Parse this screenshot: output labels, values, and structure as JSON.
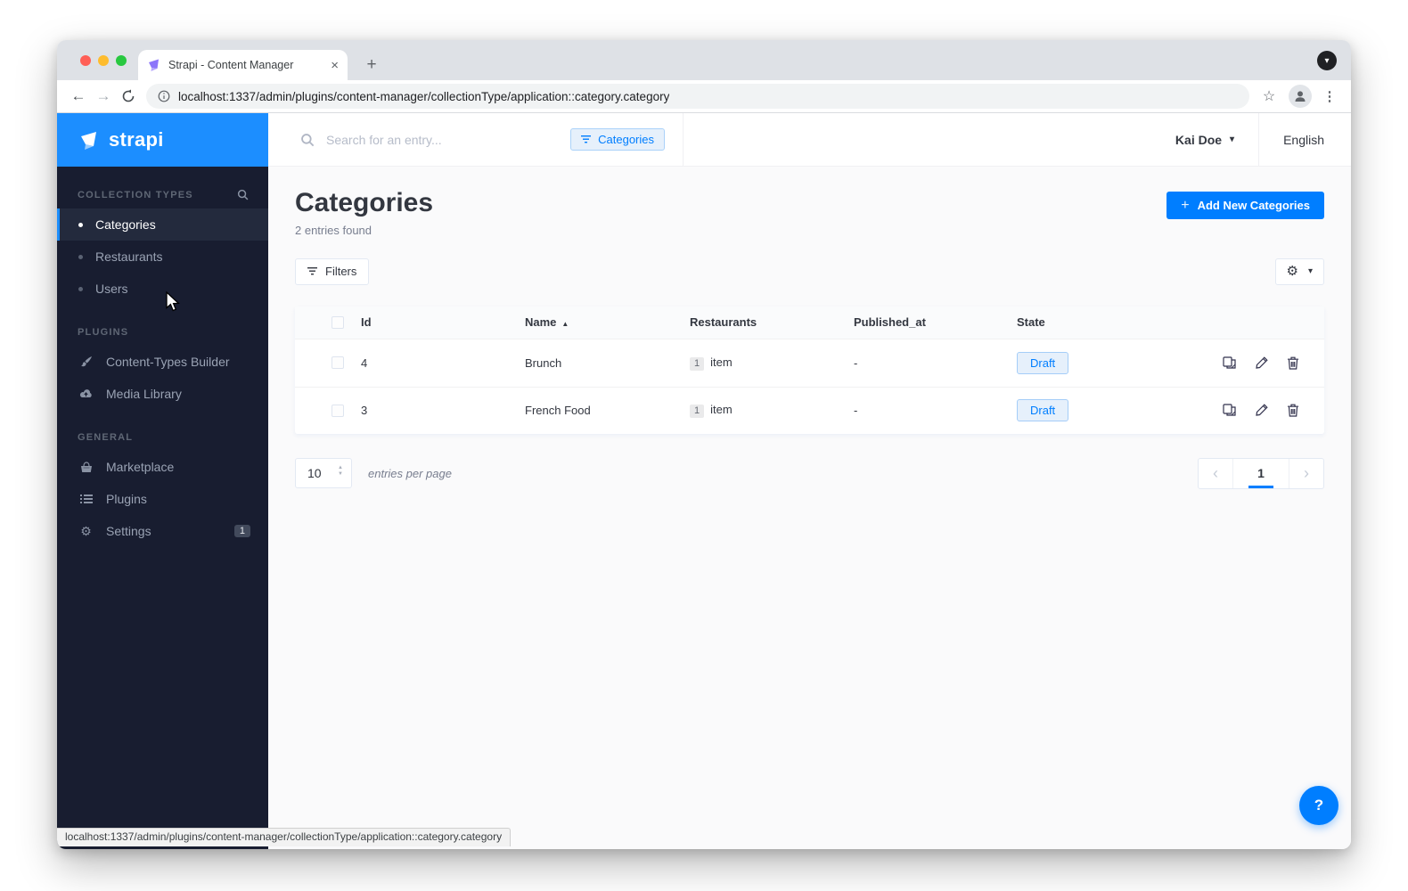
{
  "browser": {
    "tab_title": "Strapi - Content Manager",
    "url": "localhost:1337/admin/plugins/content-manager/collectionType/application::category.category",
    "status_url": "localhost:1337/admin/plugins/content-manager/collectionType/application::category.category"
  },
  "icons": {
    "close": "×",
    "plus": "+",
    "caret_down": "▾",
    "chevron_down": "▾",
    "sort_asc": "▲",
    "chevron_left": "‹",
    "chevron_right": "›",
    "star": "☆",
    "dots": "⋮",
    "back": "←",
    "forward": "→",
    "question": "?",
    "stepper_up": "▲",
    "stepper_down": "▼",
    "gear": "⚙"
  },
  "sidebar": {
    "logo_text": "strapi",
    "sections": [
      {
        "label": "COLLECTION TYPES",
        "items": [
          {
            "label": "Categories"
          },
          {
            "label": "Restaurants"
          },
          {
            "label": "Users"
          }
        ]
      },
      {
        "label": "PLUGINS",
        "items": [
          {
            "label": "Content-Types Builder"
          },
          {
            "label": "Media Library"
          }
        ]
      },
      {
        "label": "GENERAL",
        "items": [
          {
            "label": "Marketplace"
          },
          {
            "label": "Plugins"
          },
          {
            "label": "Settings",
            "badge": "1"
          }
        ]
      }
    ]
  },
  "header": {
    "search_placeholder": "Search for an entry...",
    "filter_chip": "Categories",
    "user_name": "Kai Doe",
    "language": "English"
  },
  "page": {
    "title": "Categories",
    "subtitle": "2 entries found",
    "add_button": "Add New Categories",
    "filters_button": "Filters"
  },
  "table": {
    "columns": [
      "Id",
      "Name",
      "Restaurants",
      "Published_at",
      "State"
    ],
    "rows": [
      {
        "id": "4",
        "name": "Brunch",
        "restaurants_count": "1",
        "restaurants_label": "item",
        "published_at": "-",
        "state": "Draft"
      },
      {
        "id": "3",
        "name": "French Food",
        "restaurants_count": "1",
        "restaurants_label": "item",
        "published_at": "-",
        "state": "Draft"
      }
    ]
  },
  "pagination": {
    "per_page": "10",
    "per_page_label": "entries per page",
    "current_page": "1"
  },
  "colors": {
    "accent": "#007eff",
    "sidebar_bg": "#181d30",
    "sidebar_header": "#1c8eff",
    "draft_badge_bg": "#e6f0fb",
    "draft_badge_border": "#a5cdf8",
    "page_bg": "#fafafb",
    "chrome_tabstrip": "#dee1e6"
  }
}
